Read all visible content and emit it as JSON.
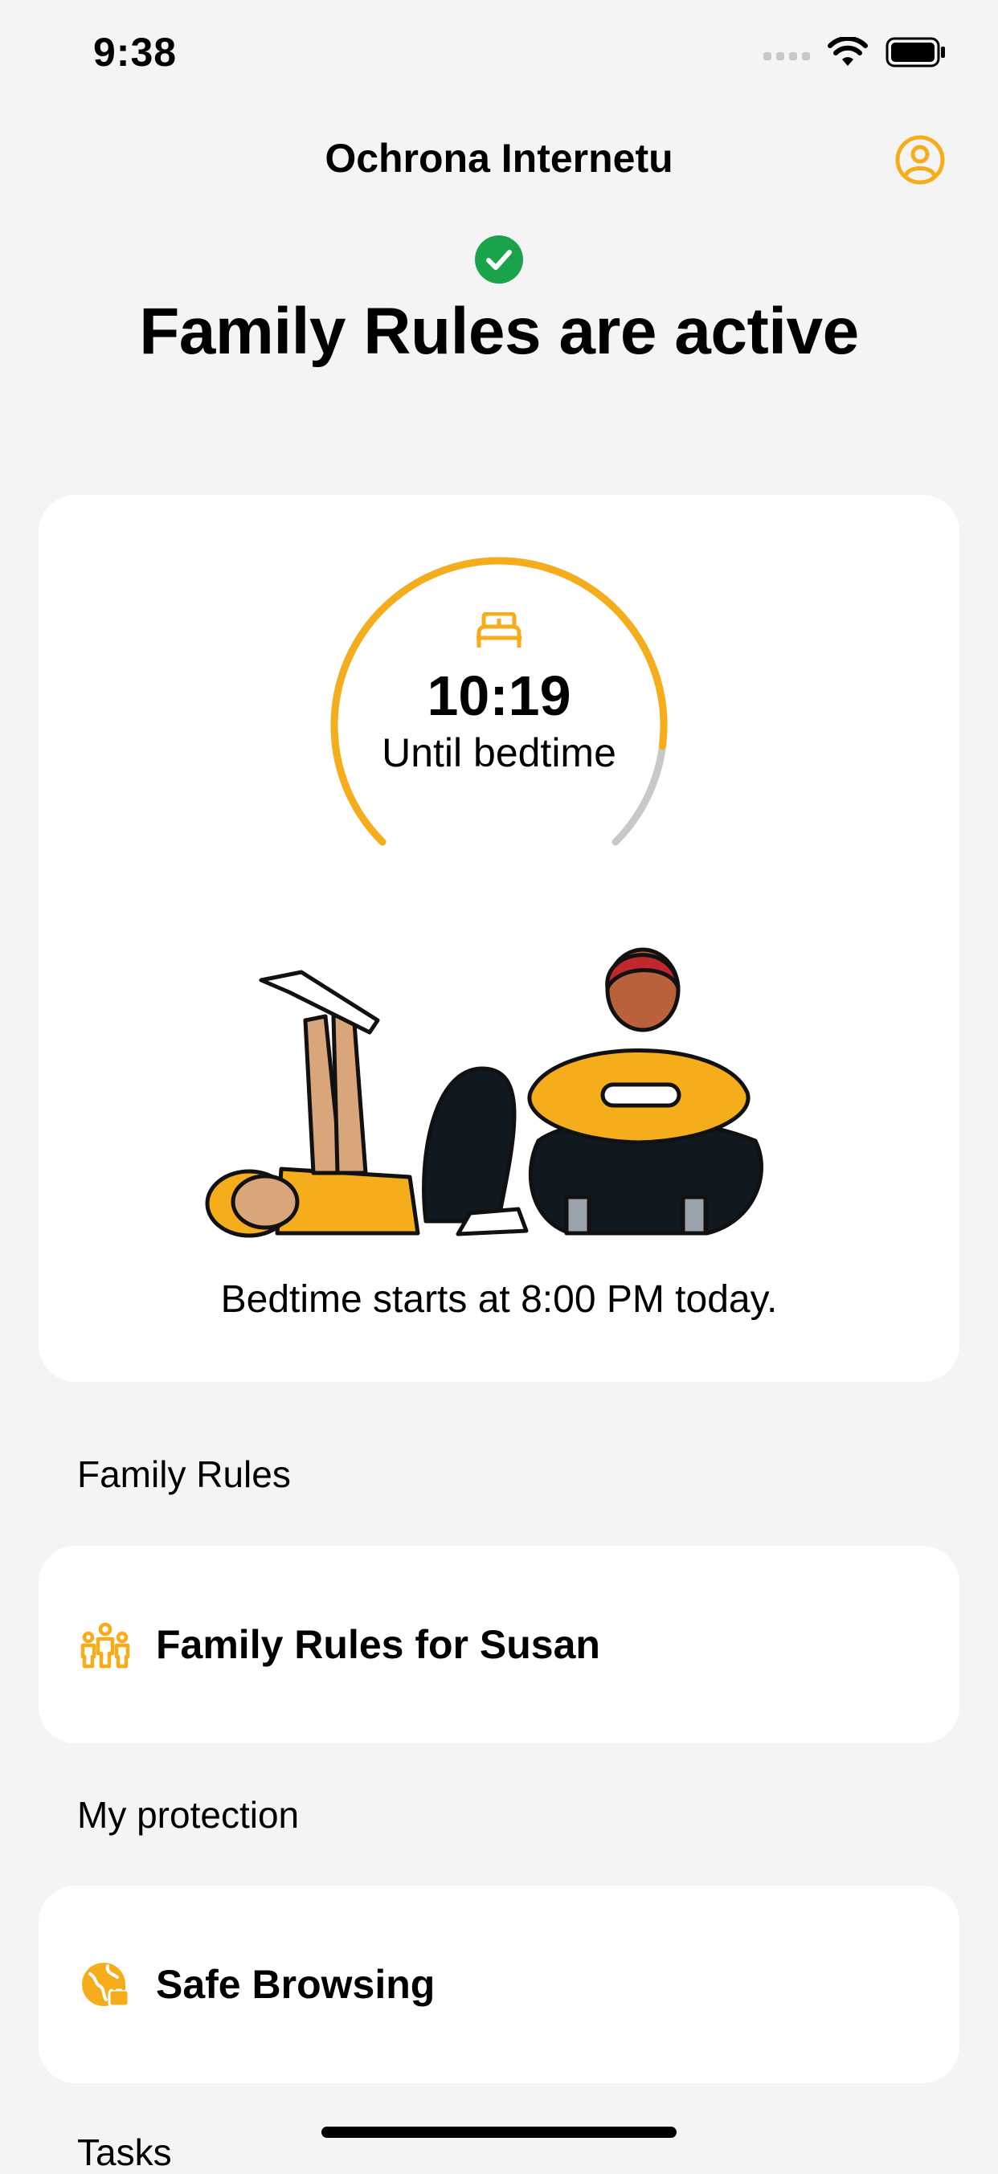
{
  "status_bar": {
    "time": "9:38"
  },
  "header": {
    "title": "Ochrona Internetu",
    "account_icon": "account-circle-icon"
  },
  "status": {
    "headline": "Family Rules are active",
    "icon": "check-circle-icon",
    "icon_color": "#1aa34a"
  },
  "bedtime": {
    "countdown": "10:19",
    "label": "Until bedtime",
    "note": "Bedtime starts at 8:00 PM today.",
    "progress": 0.86,
    "accent_color": "#f5ad1b",
    "track_color": "#c8c8c8",
    "icon": "bed-icon"
  },
  "sections": {
    "family_rules_label": "Family Rules",
    "family_rules_item": "Family Rules for Susan",
    "family_rules_icon": "family-icon",
    "my_protection_label": "My protection",
    "safe_browsing_item": "Safe Browsing",
    "safe_browsing_icon": "globe-lock-icon",
    "tasks_label": "Tasks"
  }
}
